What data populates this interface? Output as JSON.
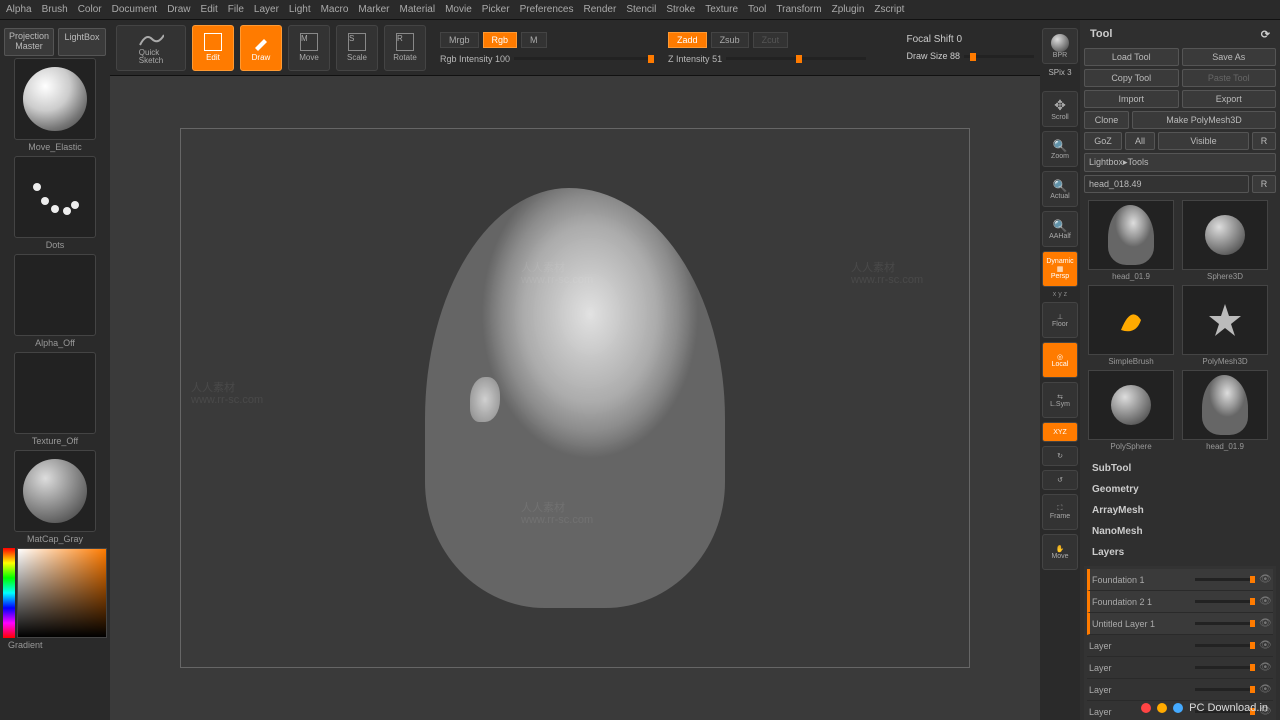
{
  "menubar": [
    "Alpha",
    "Brush",
    "Color",
    "Document",
    "Draw",
    "Edit",
    "File",
    "Layer",
    "Light",
    "Macro",
    "Marker",
    "Material",
    "Movie",
    "Picker",
    "Preferences",
    "Render",
    "Stencil",
    "Stroke",
    "Texture",
    "Tool",
    "Transform",
    "Zplugin",
    "Zscript"
  ],
  "left": {
    "projection": "Projection\nMaster",
    "lightbox": "LightBox",
    "quicksketch": "Quick\nSketch",
    "brush_label": "Move_Elastic",
    "stroke_label": "Dots",
    "alpha_label": "Alpha_Off",
    "texture_label": "Texture_Off",
    "material_label": "MatCap_Gray",
    "gradient": "Gradient"
  },
  "toolbar": {
    "edit": "Edit",
    "draw": "Draw",
    "move": "Move",
    "scale": "Scale",
    "rotate": "Rotate",
    "mrgb": "Mrgb",
    "rgb": "Rgb",
    "m": "M",
    "rgb_intensity": "Rgb Intensity 100",
    "zadd": "Zadd",
    "zsub": "Zsub",
    "zcut": "Zcut",
    "z_intensity": "Z Intensity 51",
    "focal_shift": "Focal Shift 0",
    "draw_size": "Draw Size 88"
  },
  "rail": {
    "bpr": "BPR",
    "spix": "SPix 3",
    "scroll": "Scroll",
    "zoom": "Zoom",
    "actual": "Actual",
    "aahalf": "AAHalf",
    "persp": "Persp",
    "dynamic": "Dynamic",
    "xyz_ax": "x y z",
    "floor": "Floor",
    "local": "Local",
    "lsym": "L.Sym",
    "xyz": "XYZ",
    "frame": "Frame",
    "move": "Move"
  },
  "panel": {
    "title": "Tool",
    "load": "Load Tool",
    "save": "Save As",
    "copy": "Copy Tool",
    "paste": "Paste Tool",
    "import": "Import",
    "export": "Export",
    "clone": "Clone",
    "makepoly": "Make PolyMesh3D",
    "goz": "GoZ",
    "all": "All",
    "visible": "Visible",
    "r": "R",
    "lightbox_tools": "Lightbox▸Tools",
    "toolname": "head_018.49",
    "items": [
      {
        "label": "head_01.9"
      },
      {
        "label": "Sphere3D"
      },
      {
        "label": "SimpleBrush"
      },
      {
        "label": "PolyMesh3D"
      },
      {
        "label": "PolySphere"
      },
      {
        "label": "head_01.9"
      }
    ],
    "sections": [
      "SubTool",
      "Geometry",
      "ArrayMesh",
      "NanoMesh",
      "Layers"
    ],
    "layers": [
      {
        "name": "Foundation 1",
        "active": true
      },
      {
        "name": "Foundation 2 1",
        "active": true
      },
      {
        "name": "Untitled Layer 1",
        "active": true
      },
      {
        "name": "Layer",
        "active": false
      },
      {
        "name": "Layer",
        "active": false
      },
      {
        "name": "Layer",
        "active": false
      },
      {
        "name": "Layer",
        "active": false
      }
    ]
  },
  "watermark": {
    "url": "www.rr-sc.com",
    "cn": "人人素材",
    "footer": "PC Download.in"
  }
}
